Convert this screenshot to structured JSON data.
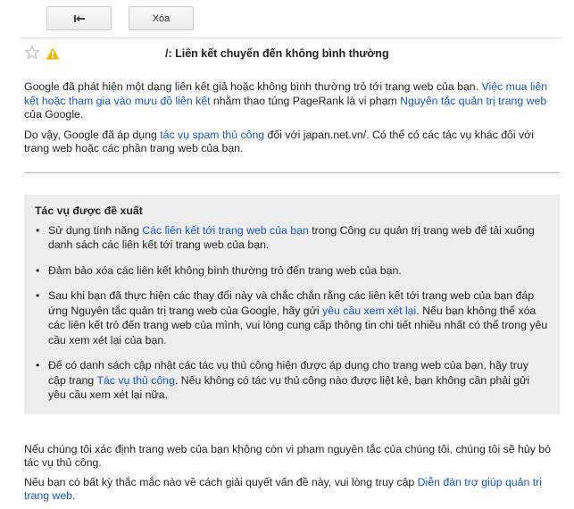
{
  "toolbar": {
    "delete_label": "Xóa",
    "back_icon": "back-arrow-icon"
  },
  "message": {
    "subject": "/: Liên kết chuyển đến không bình thường",
    "star_icon": "star-icon",
    "warning_icon": "warning-icon",
    "warning_color": "#f4b400"
  },
  "body": {
    "p1_a": "Google đã phát hiện một dạng liên kết giả hoặc không bình thường trỏ tới trang web của bạn. ",
    "p1_link1": "Việc mua liên kết hoặc tham gia vào mưu đồ liên kết",
    "p1_b": " nhằm thao túng PageRank là vi phạm ",
    "p1_link2": "Nguyên tắc quản trị trang web",
    "p1_c": " của Google.",
    "p2_a": "Do vậy, Google đã áp dụng ",
    "p2_link": "tác vụ spam thủ công",
    "p2_b": " đối với japan.net.vn/. Có thể có các tác vụ khác đối với trang web hoặc các phần trang web của bạn."
  },
  "recommend": {
    "title": "Tác vụ được đề xuất",
    "bullet": "•",
    "item1_a": "Sử dụng tính năng ",
    "item1_link": "Các liên kết tới trang web của bạn",
    "item1_b": " trong Công cụ quản trị trang web để tải xuống danh sách các liên kết tới trang web của bạn.",
    "item2": "Đảm bảo xóa các liên kết không bình thường trỏ đến trang web của bạn.",
    "item3_a": "Sau khi bạn đã thực hiện các thay đổi này và chắc chắn rằng các liên kết tới trang web của bạn đáp ứng Nguyên tắc quản trị trang web của Google, hãy gửi ",
    "item3_link": "yêu cầu xem xét lại",
    "item3_b": ". Nếu bạn không thể xóa các liên kết trỏ đến trang web của mình, vui lòng cung cấp thông tin chi tiết nhiều nhất có thể trong yêu cầu xem xét lại của bạn.",
    "item4_a": "Để có danh sách cập nhật các tác vụ thủ công hiện được áp dụng cho trang web của bạn, hãy truy cập trang ",
    "item4_link": "Tác vụ thủ công",
    "item4_b": ". Nếu không có tác vụ thủ công nào được liệt kê, bạn không cần phải gửi yêu cầu xem xét lại nữa."
  },
  "footer": {
    "p1": "Nếu chúng tôi xác định trang web của bạn không còn vi phạm nguyên tắc của chúng tôi, chúng tôi sẽ hủy bỏ tác vụ thủ công.",
    "p2_a": "Nếu bạn có bất kỳ thắc mắc nào về cách giải quyết vấn đề này, vui lòng truy cập ",
    "p2_link": "Diễn đàn trợ giúp quản trị trang web",
    "p2_b": "."
  }
}
